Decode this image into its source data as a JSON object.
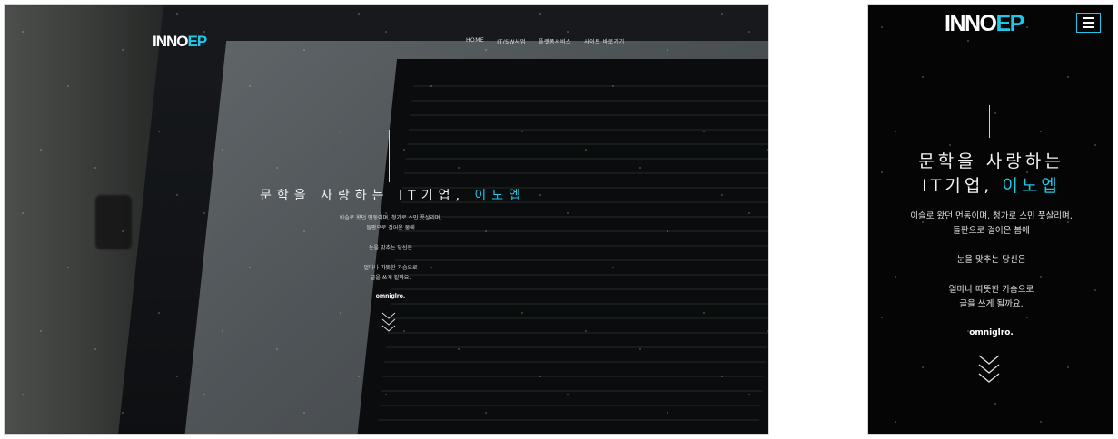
{
  "desktop": {
    "logo_main": "INNO",
    "logo_accent": "EP",
    "nav": [
      "HOME",
      "IT/SW사업",
      "플랫폼서비스",
      "사이트 바로가기"
    ],
    "title_main": "문학을 사랑하는 IT기업,",
    "title_highlight": "이노엡",
    "poem_line1": "이슬로 왔던 먼동이며, 청가로 스민 풋살리며,",
    "poem_line2": "들판으로 걸어온 봄에",
    "poem_line3": "눈을 맞추는 당신은",
    "poem_line4": "얼마나 따뜻한 가슴으로",
    "poem_line5": "글을 쓰게 될까요.",
    "signature": "omniglro."
  },
  "mobile": {
    "logo_main": "INNO",
    "logo_accent": "EP",
    "title_line1": "문학을 사랑하는",
    "title_line2_main": "IT기업,",
    "title_line2_highlight": "이노엡",
    "poem_line1": "이슬로 왔던 먼동이며, 청가로 스민 풋살리며,",
    "poem_line2": "들판으로 걸어온 봄에",
    "poem_line3": "눈을 맞추는 당신은",
    "poem_line4": "얼마나 따뜻한 가슴으로",
    "poem_line5": "글을 쓰게 될까요.",
    "signature": "omniglro."
  },
  "icons": {
    "menu": "hamburger-menu-icon",
    "scroll": "chevron-down-triple-icon"
  },
  "colors": {
    "accent": "#1ec8e6",
    "background_mobile": "#050505"
  }
}
